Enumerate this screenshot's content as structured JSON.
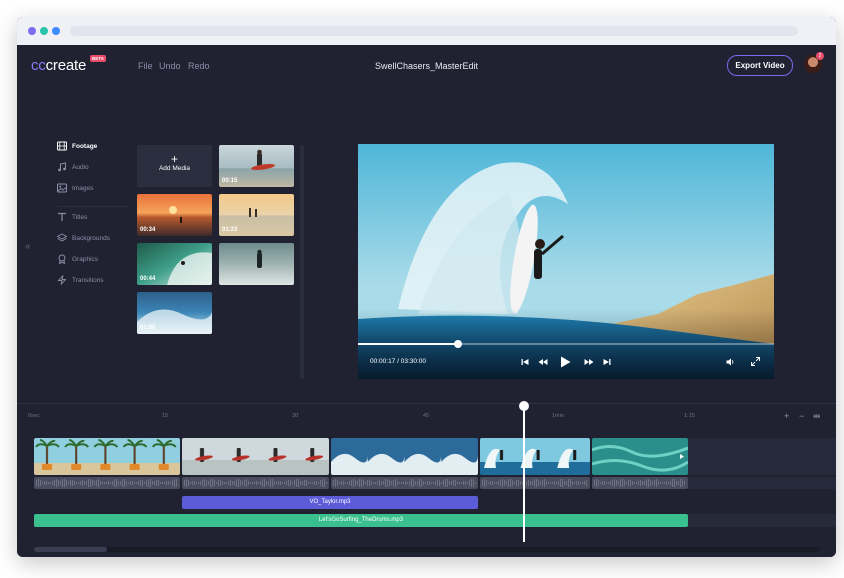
{
  "app": {
    "logo_cc": "cc",
    "logo_rest": "create",
    "beta_label": "BETA",
    "menu": {
      "file": "File",
      "undo": "Undo",
      "redo": "Redo"
    },
    "project_title": "SwellChasers_MasterEdit",
    "export_label": "Export Video",
    "notification_count": "2"
  },
  "sidebar": {
    "items": [
      {
        "label": "Footage",
        "icon": "film-icon",
        "active": true
      },
      {
        "label": "Audio",
        "icon": "music-note-icon",
        "active": false
      },
      {
        "label": "Images",
        "icon": "image-icon",
        "active": false
      },
      {
        "label": "Titles",
        "icon": "text-icon",
        "active": false
      },
      {
        "label": "Backgrounds",
        "icon": "layers-icon",
        "active": false
      },
      {
        "label": "Graphics",
        "icon": "badge-icon",
        "active": false
      },
      {
        "label": "Transitions",
        "icon": "lightning-icon",
        "active": false
      }
    ]
  },
  "media": {
    "add_label": "Add Media",
    "thumbs": [
      {
        "duration": "00:15"
      },
      {
        "duration": "00:34"
      },
      {
        "duration": "01:23"
      },
      {
        "duration": "00:44"
      },
      {
        "duration": ""
      },
      {
        "duration": "01:08"
      }
    ]
  },
  "preview": {
    "time": "00:00:17 / 03:30:00",
    "progress": 0.24
  },
  "timeline": {
    "ticks": [
      "0sec",
      "15",
      "30",
      "45",
      "1min",
      "1:15"
    ],
    "vo_track": "VO_Taylor.mp3",
    "music_track": "Let'sGoSurfing_TheDrums.mp3"
  },
  "colors": {
    "accent": "#7b68ee",
    "background": "#202232",
    "vo": "#5c5bd8",
    "music": "#39c08e",
    "badge": "#e84c6a"
  }
}
